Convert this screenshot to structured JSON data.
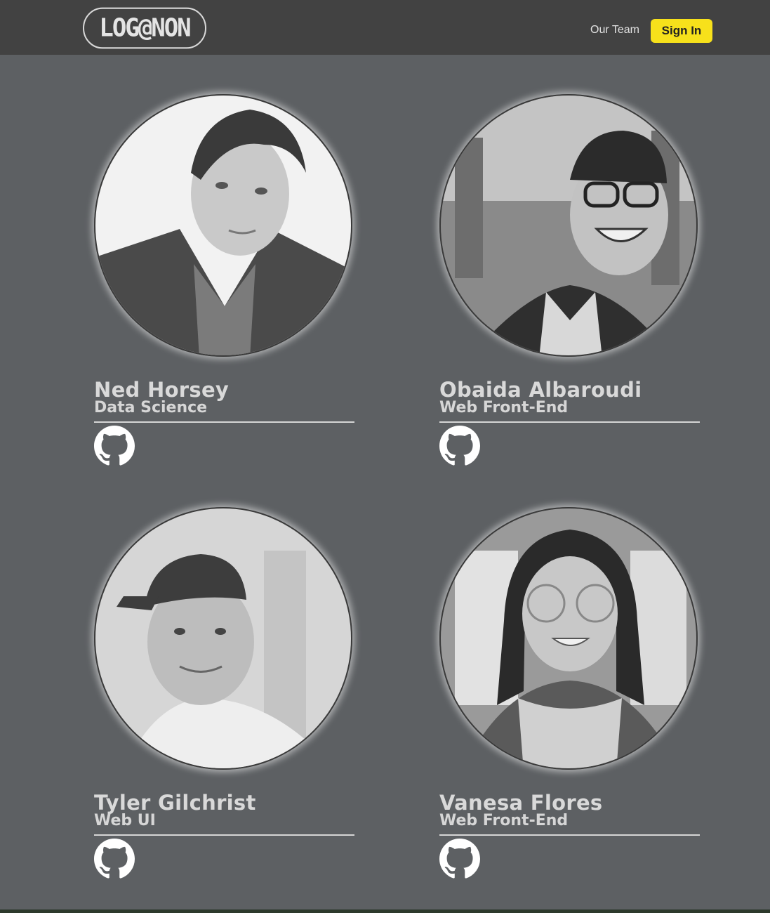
{
  "header": {
    "logo_text": "LOG@NON",
    "nav": {
      "our_team": "Our Team"
    },
    "sign_in": "Sign In"
  },
  "colors": {
    "header_bg": "#424242",
    "page_bg": "#5d6063",
    "accent": "#f7e11b"
  },
  "team": [
    {
      "name": "Ned Horsey",
      "role": "Data Science",
      "link_icon": "github-icon"
    },
    {
      "name": "Obaida Albaroudi",
      "role": "Web Front-End",
      "link_icon": "github-icon"
    },
    {
      "name": "Tyler Gilchrist",
      "role": "Web UI",
      "link_icon": "github-icon"
    },
    {
      "name": "Vanesa Flores",
      "role": "Web Front-End",
      "link_icon": "github-icon"
    }
  ]
}
